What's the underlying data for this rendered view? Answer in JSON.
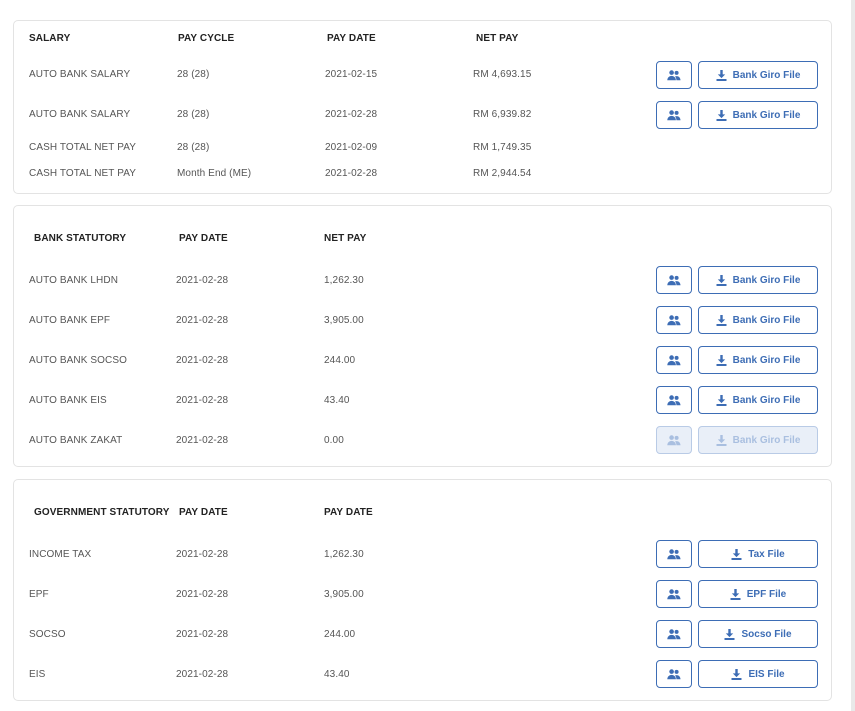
{
  "salary": {
    "headers": {
      "col1": "SALARY",
      "col2": "PAY CYCLE",
      "col3": "PAY DATE",
      "col4": "NET PAY"
    },
    "rows": [
      {
        "name": "AUTO BANK SALARY",
        "cycle": "28 (28)",
        "date": "2021-02-15",
        "net": "RM 4,693.15",
        "button": "Bank Giro File"
      },
      {
        "name": "AUTO BANK SALARY",
        "cycle": "28 (28)",
        "date": "2021-02-28",
        "net": "RM 6,939.82",
        "button": "Bank Giro File"
      },
      {
        "name": "CASH TOTAL NET PAY",
        "cycle": "28 (28)",
        "date": "2021-02-09",
        "net": "RM 1,749.35"
      },
      {
        "name": "CASH TOTAL NET PAY",
        "cycle": "Month End (ME)",
        "date": "2021-02-28",
        "net": "RM 2,944.54"
      }
    ]
  },
  "bank_statutory": {
    "headers": {
      "col1": "BANK STATUTORY",
      "col2": "PAY DATE",
      "col3": "NET PAY"
    },
    "rows": [
      {
        "name": "AUTO BANK LHDN",
        "date": "2021-02-28",
        "net": "1,262.30",
        "button": "Bank Giro File"
      },
      {
        "name": "AUTO BANK EPF",
        "date": "2021-02-28",
        "net": "3,905.00",
        "button": "Bank Giro File"
      },
      {
        "name": "AUTO BANK SOCSO",
        "date": "2021-02-28",
        "net": "244.00",
        "button": "Bank Giro File"
      },
      {
        "name": "AUTO BANK EIS",
        "date": "2021-02-28",
        "net": "43.40",
        "button": "Bank Giro File"
      },
      {
        "name": "AUTO BANK ZAKAT",
        "date": "2021-02-28",
        "net": "0.00",
        "button": "Bank Giro File",
        "disabled": true
      }
    ]
  },
  "government_statutory": {
    "headers": {
      "col1": "GOVERNMENT STATUTORY",
      "col2": "PAY DATE",
      "col3": "PAY DATE"
    },
    "rows": [
      {
        "name": "INCOME TAX",
        "date": "2021-02-28",
        "net": "1,262.30",
        "button": "Tax File"
      },
      {
        "name": "EPF",
        "date": "2021-02-28",
        "net": "3,905.00",
        "button": "EPF File"
      },
      {
        "name": "SOCSO",
        "date": "2021-02-28",
        "net": "244.00",
        "button": "Socso File"
      },
      {
        "name": "EIS",
        "date": "2021-02-28",
        "net": "43.40",
        "button": "EIS File"
      }
    ]
  },
  "icons": {
    "users": "users-icon",
    "download": "download-icon"
  },
  "colors": {
    "accent": "#3d6db5",
    "disabled_bg": "#e9eff8",
    "border": "#e3e3e3"
  }
}
